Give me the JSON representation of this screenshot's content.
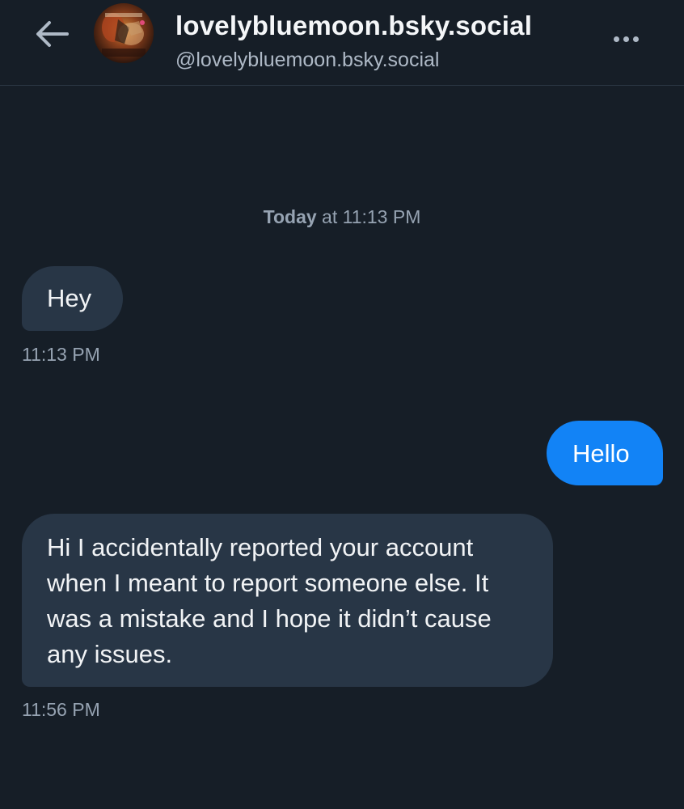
{
  "header": {
    "back_icon": "arrow-left-icon",
    "display_name": "lovelybluemoon.bsky.social",
    "handle": "@lovelybluemoon.bsky.social",
    "more_icon": "ellipsis-icon"
  },
  "conversation": {
    "date_label_day": "Today",
    "date_label_rest": " at 11:13 PM",
    "messages": [
      {
        "direction": "incoming",
        "text": "Hey",
        "time": "11:13 PM"
      },
      {
        "direction": "outgoing",
        "text": "Hello",
        "time": ""
      },
      {
        "direction": "incoming",
        "text": "Hi I accidentally reported your account when I meant to report someone else. It was a mistake and I hope it didn’t cause any issues.",
        "time": "11:56 PM"
      }
    ]
  },
  "colors": {
    "background": "#161e27",
    "incoming_bubble": "#283646",
    "outgoing_bubble": "#1283f6",
    "muted_text": "#96a3b2"
  }
}
